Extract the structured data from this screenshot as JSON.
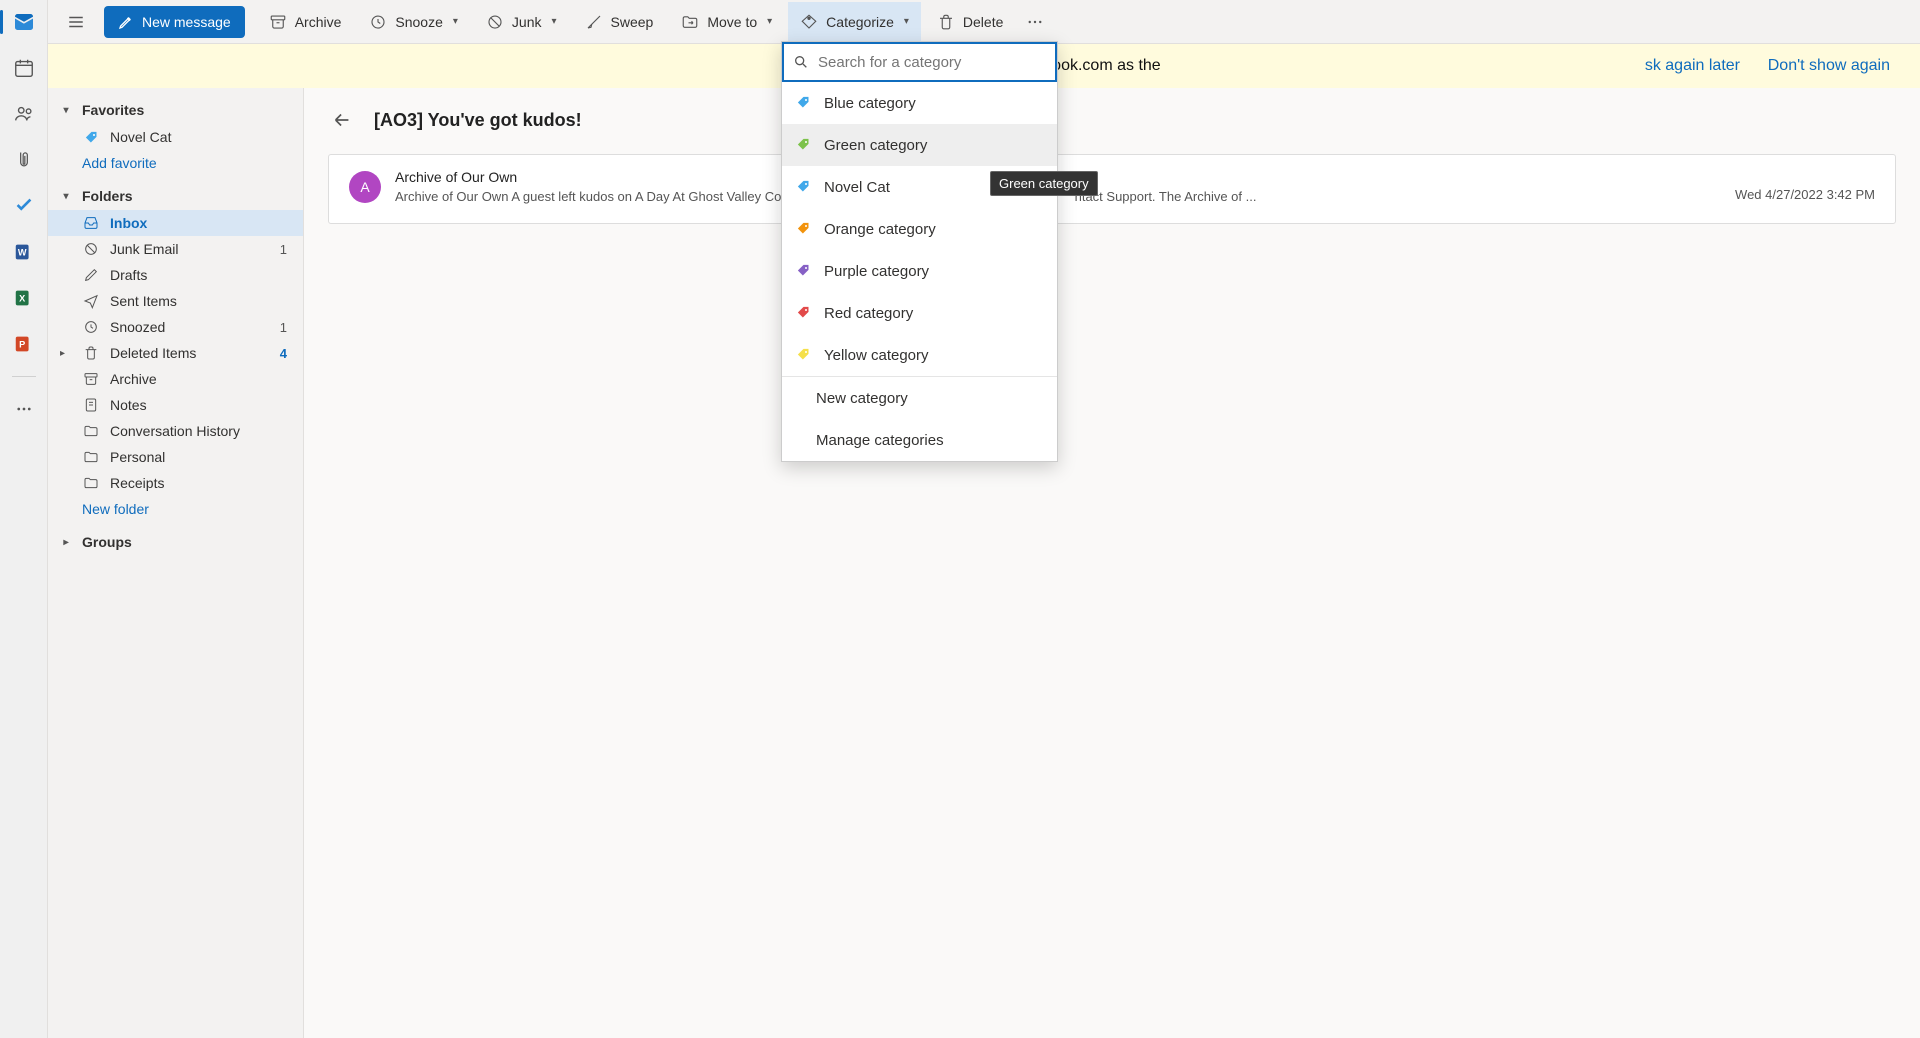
{
  "apprail": {
    "mail_name": "mail-icon",
    "calendar_name": "calendar-icon",
    "people_name": "people-icon",
    "files_name": "files-icon",
    "todo_name": "todo-icon",
    "word_name": "word-icon",
    "excel_name": "excel-icon",
    "ppt_name": "powerpoint-icon",
    "more_name": "more-apps-icon"
  },
  "toolbar": {
    "new_message": "New message",
    "archive": "Archive",
    "snooze": "Snooze",
    "junk": "Junk",
    "sweep": "Sweep",
    "move_to": "Move to",
    "categorize": "Categorize",
    "delete": "Delete"
  },
  "banner": {
    "text": "Your browser supports setting Outlook.com as the ",
    "ask_later": "sk again later",
    "dont_show": "Don't show again"
  },
  "sidebar": {
    "favorites_header": "Favorites",
    "favorites": [
      {
        "label": "Novel Cat",
        "icon": "tag",
        "color": "#40a8ea"
      }
    ],
    "add_favorite": "Add favorite",
    "folders_header": "Folders",
    "folders": [
      {
        "label": "Inbox",
        "icon": "inbox",
        "selected": true
      },
      {
        "label": "Junk Email",
        "icon": "junk",
        "count": "1"
      },
      {
        "label": "Drafts",
        "icon": "drafts"
      },
      {
        "label": "Sent Items",
        "icon": "sent"
      },
      {
        "label": "Snoozed",
        "icon": "snoozed",
        "count": "1"
      },
      {
        "label": "Deleted Items",
        "icon": "trash",
        "count": "4",
        "count_blue": true,
        "has_caret": true
      },
      {
        "label": "Archive",
        "icon": "archive"
      },
      {
        "label": "Notes",
        "icon": "notes"
      },
      {
        "label": "Conversation History",
        "icon": "folder"
      },
      {
        "label": "Personal",
        "icon": "folder"
      },
      {
        "label": "Receipts",
        "icon": "folder"
      }
    ],
    "new_folder": "New folder",
    "groups_header": "Groups"
  },
  "reading": {
    "subject": "[AO3] You've got kudos!",
    "message": {
      "avatar_initial": "A",
      "sender": "Archive of Our Own",
      "preview_lead": "Archive of Our Own A guest left kudos on A Day At Ghost Valley Corp. If",
      "preview_tail": "ntact Support. The Archive of ...",
      "date": "Wed 4/27/2022 3:42 PM"
    }
  },
  "dropdown": {
    "search_placeholder": "Search for a category",
    "items": [
      {
        "label": "Blue category",
        "color": "#40a8ea"
      },
      {
        "label": "Green category",
        "color": "#7cc24a",
        "hovered": true
      },
      {
        "label": "Novel Cat",
        "color": "#40a8ea"
      },
      {
        "label": "Orange category",
        "color": "#f2930d"
      },
      {
        "label": "Purple category",
        "color": "#8660c5"
      },
      {
        "label": "Red category",
        "color": "#e24a4a"
      },
      {
        "label": "Yellow category",
        "color": "#f5e04a"
      }
    ],
    "new_category": "New category",
    "manage_categories": "Manage categories"
  },
  "tooltip": "Green category"
}
